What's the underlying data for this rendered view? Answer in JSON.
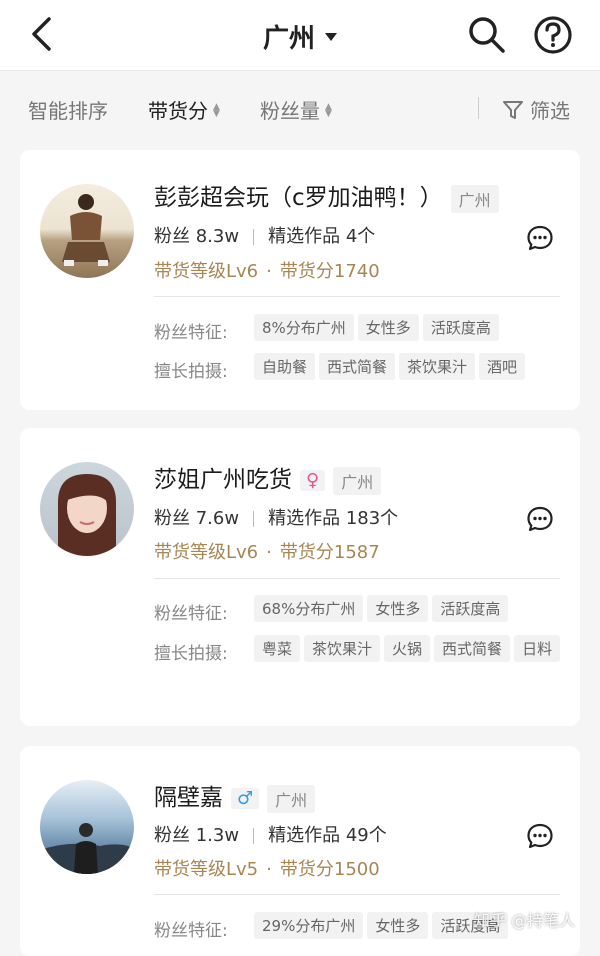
{
  "header": {
    "title": "广州"
  },
  "sortbar": {
    "items": [
      "智能排序",
      "带货分",
      "粉丝量"
    ],
    "filter": "筛选"
  },
  "cards": [
    {
      "name": "彭彭超会玩（c罗加油鸭！）",
      "location": "广州",
      "gender": "",
      "fans_label": "粉丝",
      "fans": "8.3w",
      "works_label": "精选作品",
      "works": "4个",
      "level": "带货等级Lv6",
      "score": "带货分1740",
      "feature_label": "粉丝特征:",
      "features": [
        "8%分布广州",
        "女性多",
        "活跃度高"
      ],
      "skill_label": "擅长拍摄:",
      "skills": [
        "自助餐",
        "西式简餐",
        "茶饮果汁",
        "酒吧"
      ]
    },
    {
      "name": "莎姐广州吃货",
      "location": "广州",
      "gender": "♀",
      "fans_label": "粉丝",
      "fans": "7.6w",
      "works_label": "精选作品",
      "works": "183个",
      "level": "带货等级Lv6",
      "score": "带货分1587",
      "feature_label": "粉丝特征:",
      "features": [
        "68%分布广州",
        "女性多",
        "活跃度高"
      ],
      "skill_label": "擅长拍摄:",
      "skills": [
        "粤菜",
        "茶饮果汁",
        "火锅",
        "西式简餐",
        "日料"
      ]
    },
    {
      "name": "隔壁嘉",
      "location": "广州",
      "gender": "♂",
      "fans_label": "粉丝",
      "fans": "1.3w",
      "works_label": "精选作品",
      "works": "49个",
      "level": "带货等级Lv5",
      "score": "带货分1500",
      "feature_label": "粉丝特征:",
      "features": [
        "29%分布广州",
        "女性多",
        "活跃度高"
      ]
    }
  ],
  "watermark": "知乎 @持笔人",
  "colors": {
    "gold": "#a88654",
    "female": "#e8558c",
    "male": "#2f9be8"
  }
}
